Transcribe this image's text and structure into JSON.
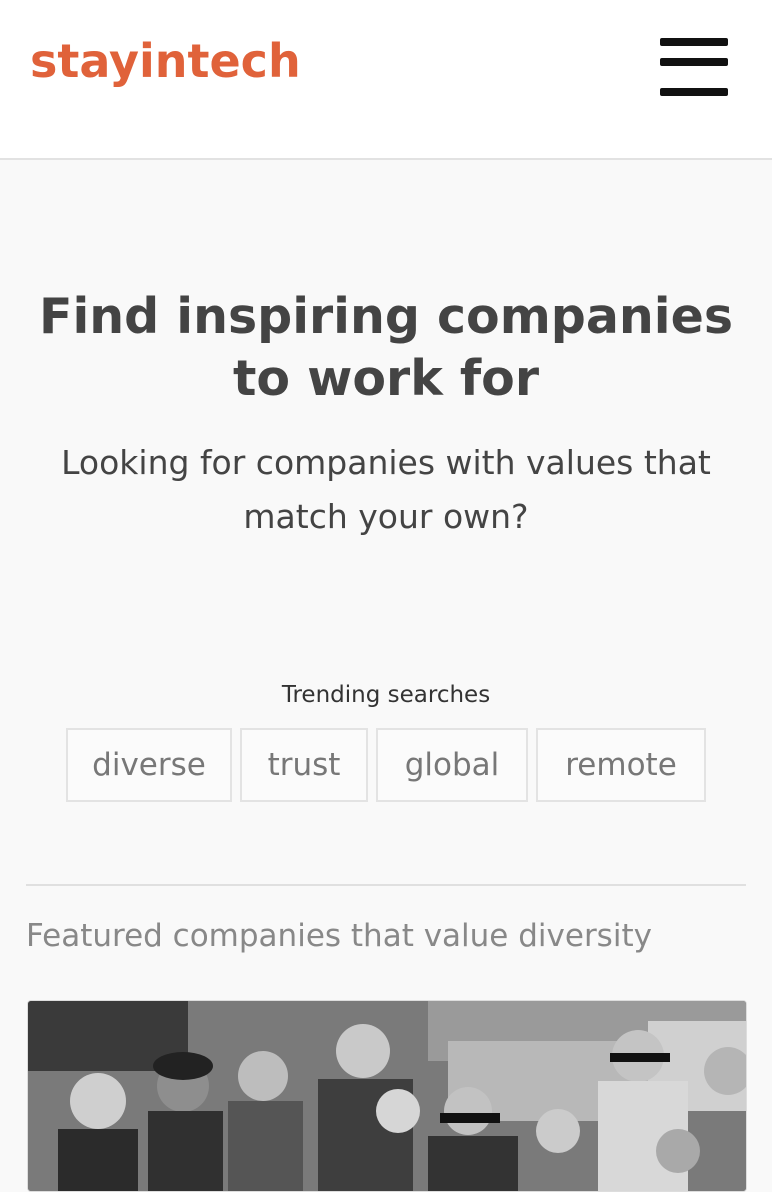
{
  "header": {
    "logo_text": "stayintech",
    "menu_icon": "hamburger-menu-icon"
  },
  "hero": {
    "title": "Find inspiring companies to work for",
    "subtitle": "Looking for companies with values that match your own?"
  },
  "trending": {
    "label": "Trending searches",
    "chips": [
      "diverse",
      "trust",
      "global",
      "remote"
    ]
  },
  "featured": {
    "heading": "Featured companies that value diversity"
  },
  "colors": {
    "brand": "#e0623a",
    "background": "#f9f9f9",
    "text": "#444444"
  }
}
